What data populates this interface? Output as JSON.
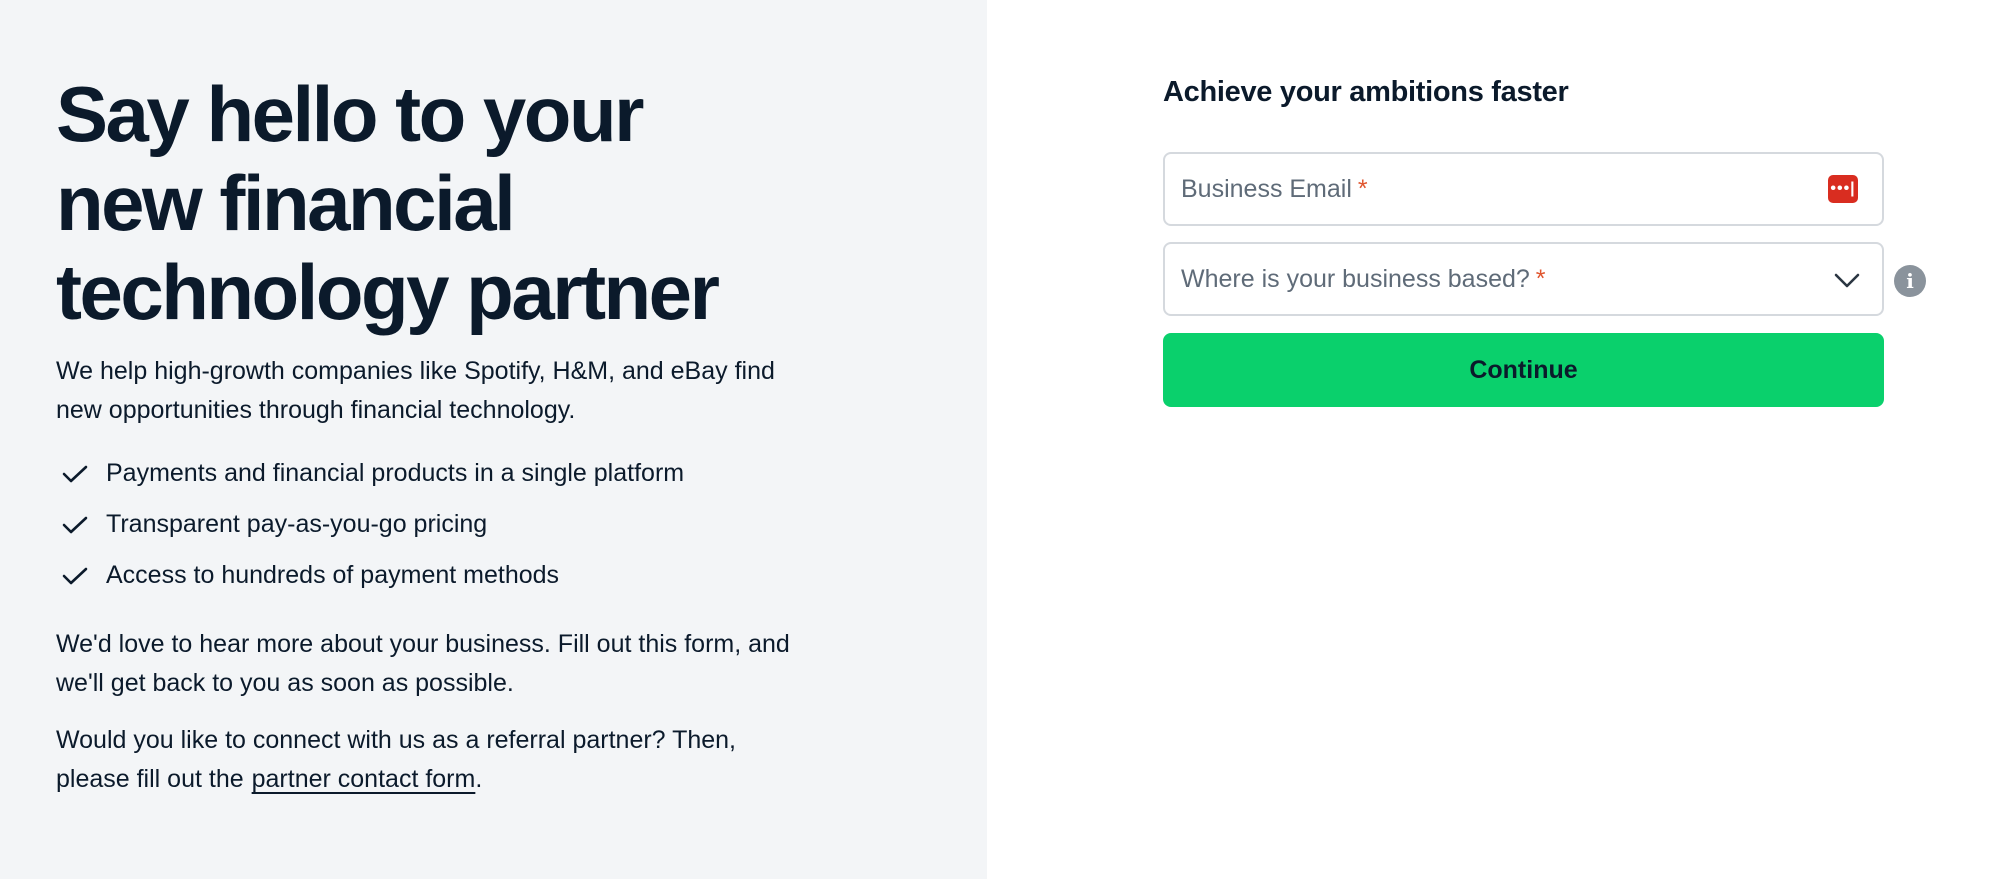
{
  "hero": {
    "title": "Say hello to your new financial technology partner",
    "intro": "We help high-growth companies like Spotify, H&M, and eBay find new opportunities through financial technology."
  },
  "features": [
    {
      "icon": "check-icon",
      "label": "Payments and financial products in a single platform"
    },
    {
      "icon": "check-icon",
      "label": "Transparent pay-as-you-go pricing"
    },
    {
      "icon": "check-icon",
      "label": "Access to hundreds of payment methods"
    }
  ],
  "business_paragraph": "We'd love to hear more about your business. Fill out this form, and we'll get back to you as soon as possible.",
  "referral": {
    "text": "Would you like to connect with us as a referral partner? Then, please fill out the",
    "link_label": "partner contact form",
    "suffix": "."
  },
  "form": {
    "title": "Achieve your ambitions faster",
    "email_placeholder": "Business Email",
    "country_placeholder": "Where is your business based?",
    "required_marker": "*",
    "password_manager_icon": "password-manager-icon",
    "password_manager_glyph": "•••|",
    "info_glyph": "i",
    "continue_label": "Continue"
  },
  "colors": {
    "left_panel_bg": "#f3f5f7",
    "text_primary": "#0b1a2b",
    "accent_green": "#0ad06c",
    "required_orange": "#e0562f",
    "password_manager_red": "#d92d20"
  }
}
